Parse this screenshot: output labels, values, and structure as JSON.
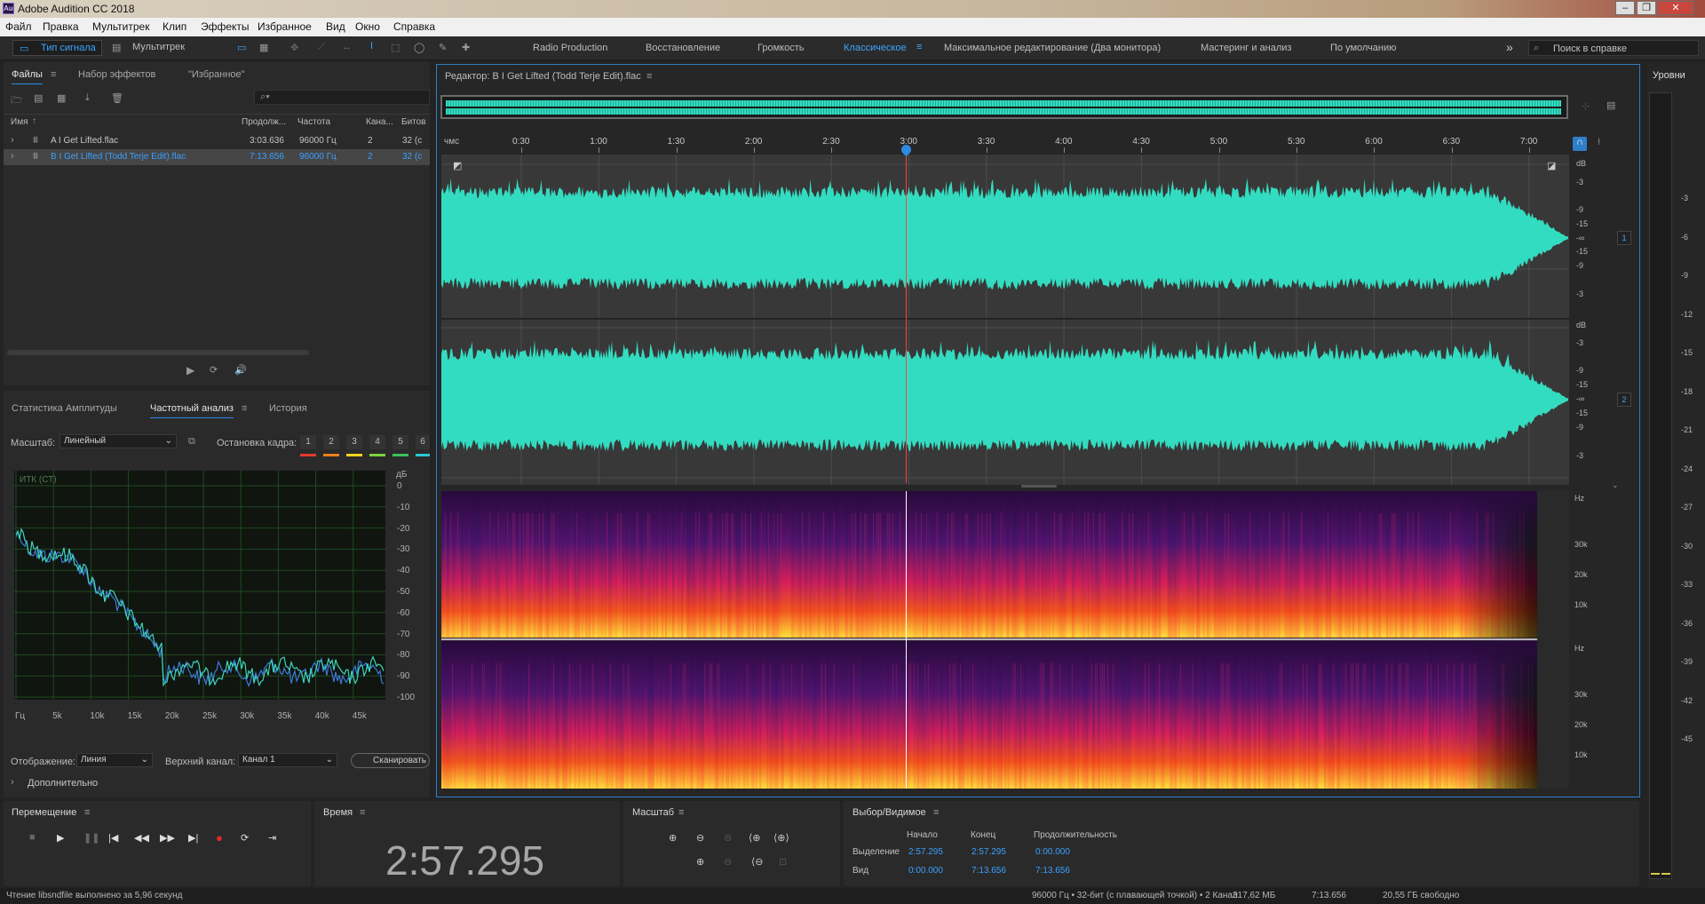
{
  "window": {
    "title": "Adobe Audition CC 2018",
    "app_icon": "Au",
    "controls": [
      "–",
      "❐",
      "✕"
    ]
  },
  "menu": [
    "Файл",
    "Правка",
    "Мультитрек",
    "Клип",
    "Эффекты",
    "Избранное",
    "Вид",
    "Окно",
    "Справка"
  ],
  "toolbar": {
    "waveform_label": "Тип сигнала",
    "multitrack_label": "Мультитрек",
    "workspaces": [
      "Radio Production",
      "Восстановление",
      "Громкость",
      "Классическое",
      "Максимальное редактирование (Два монитора)",
      "Мастеринг и анализ",
      "По умолчанию"
    ],
    "active_workspace": "Классическое",
    "search_placeholder": "Поиск в справке",
    "more": "»"
  },
  "files_panel": {
    "tabs": [
      "Файлы",
      "Набор эффектов",
      "\"Избранное\""
    ],
    "search_icon": "⌕▾",
    "columns": [
      "Имя",
      "Продолж...",
      "Частота",
      "Кана...",
      "Битов"
    ],
    "rows": [
      {
        "name": "A I Get Lifted.flac",
        "duration": "3:03.636",
        "rate": "96000 Гц",
        "channels": "2",
        "bits": "32 (с"
      },
      {
        "name": "B I Get Lifted (Todd Terje Edit).flac",
        "duration": "7:13.656",
        "rate": "96000 Гц",
        "channels": "2",
        "bits": "32 (с"
      }
    ]
  },
  "analysis_panel": {
    "tabs": [
      "Статистика Амплитуды",
      "Частотный анализ",
      "История"
    ],
    "scale_label": "Масштаб:",
    "scale_value": "Линейный",
    "freeze_label": "Остановка кадра:",
    "frames": [
      "1",
      "2",
      "3",
      "4",
      "5",
      "6"
    ],
    "frame_colors": [
      "#e23b2e",
      "#f07f1c",
      "#f3d21e",
      "#7cd23a",
      "#3ac15a",
      "#2bc6d6"
    ],
    "graph_label": "ИТК (СТ)",
    "db_unit": "дБ",
    "db_ticks": [
      "0",
      "-10",
      "-20",
      "-30",
      "-40",
      "-50",
      "-60",
      "-70",
      "-80",
      "-90",
      "-100"
    ],
    "freq_ticks": [
      "Гц",
      "5k",
      "10k",
      "15k",
      "20k",
      "25k",
      "30k",
      "35k",
      "40k",
      "45k"
    ],
    "display_label": "Отображение:",
    "display_value": "Линия",
    "channel_label": "Верхний канал:",
    "channel_value": "Канал 1",
    "scan_button": "Сканировать",
    "advanced": "Дополнительно"
  },
  "editor": {
    "title": "Редактор: B I Get Lifted (Todd Terje Edit).flac",
    "time_unit": "чмс",
    "time_ticks": [
      "0:30",
      "1:00",
      "1:30",
      "2:00",
      "2:30",
      "3:00",
      "3:30",
      "4:00",
      "4:30",
      "5:00",
      "5:30",
      "6:00",
      "6:30",
      "7:00"
    ],
    "db_unit": "dB",
    "db_ticks": [
      "-3",
      "-9",
      "-15",
      "-∞",
      "-15",
      "-9",
      "-3"
    ],
    "channel_badges": [
      "1",
      "2"
    ],
    "hz_unit": "Hz",
    "hz_ticks": [
      "30k",
      "20k",
      "10k"
    ],
    "waveform_color": "#32dcc0",
    "playhead_fraction": 0.4115
  },
  "levels": {
    "title": "Уровни",
    "ticks": [
      "-3",
      "-6",
      "-9",
      "-12",
      "-15",
      "-18",
      "-21",
      "-24",
      "-27",
      "-30",
      "-33",
      "-36",
      "-39",
      "-42",
      "-45"
    ]
  },
  "transport": {
    "title": "Перемещение",
    "buttons": [
      "■",
      "▶",
      "❚❚",
      "|◀",
      "◀◀",
      "▶▶",
      "▶|",
      "●",
      "⟳",
      "⇥"
    ]
  },
  "time_panel": {
    "title": "Время",
    "value": "2:57.295"
  },
  "zoom_panel": {
    "title": "Масштаб"
  },
  "selection_panel": {
    "title": "Выбор/Видимое",
    "headers": [
      "Начало",
      "Конец",
      "Продолжительность"
    ],
    "rows": [
      {
        "label": "Выделение",
        "start": "2:57.295",
        "end": "2:57.295",
        "duration": "0:00.000"
      },
      {
        "label": "Вид",
        "start": "0:00.000",
        "end": "7:13.656",
        "duration": "7:13.656"
      }
    ]
  },
  "status": {
    "message": "Чтение libsndfile выполнено за 5,96 секунд",
    "format": "96000 Гц • 32-бит (с плавающей точкой) • 2 Канал",
    "size": "317,62 МБ",
    "duration": "7:13.656",
    "free": "20,55 ГБ свободно"
  }
}
